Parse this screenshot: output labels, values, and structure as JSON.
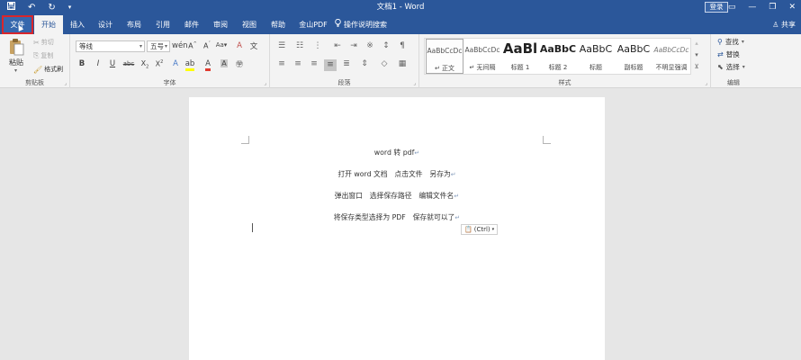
{
  "titlebar": {
    "title": "文档1 - Word",
    "login": "登录",
    "qat": {
      "save_icon": "save-icon",
      "undo_icon": "undo-icon",
      "redo_icon": "redo-icon",
      "customize_icon": "chevron-down-icon"
    },
    "window_buttons": [
      "▭",
      "—",
      "❐",
      "✕"
    ]
  },
  "tabs": [
    {
      "label": "文件"
    },
    {
      "label": "开始"
    },
    {
      "label": "插入"
    },
    {
      "label": "设计"
    },
    {
      "label": "布局"
    },
    {
      "label": "引用"
    },
    {
      "label": "邮件"
    },
    {
      "label": "审阅"
    },
    {
      "label": "视图"
    },
    {
      "label": "帮助"
    },
    {
      "label": "金山PDF"
    },
    {
      "label": "操作说明搜索"
    }
  ],
  "share": "共享",
  "clipboard": {
    "paste": "粘贴",
    "cut": "剪切",
    "copy": "复制",
    "format_painter": "格式刷",
    "group_label": "剪贴板"
  },
  "font": {
    "font_name": "等线",
    "font_size": "五号",
    "group_label": "字体"
  },
  "paragraph": {
    "group_label": "段落"
  },
  "styles": {
    "group_label": "样式",
    "items": [
      {
        "preview": "AaBbCcDc",
        "name": "↵ 正文"
      },
      {
        "preview": "AaBbCcDc",
        "name": "↵ 无间隔"
      },
      {
        "preview": "AaBl",
        "name": "标题 1"
      },
      {
        "preview": "AaBbC",
        "name": "标题 2"
      },
      {
        "preview": "AaBbC",
        "name": "标题"
      },
      {
        "preview": "AaBbC",
        "name": "副标题"
      },
      {
        "preview": "AaBbCcDc",
        "name": "不明显强调"
      }
    ]
  },
  "editing": {
    "find": "查找",
    "replace": "替换",
    "select": "选择",
    "group_label": "编辑"
  },
  "document": {
    "lines": [
      "word 转 pdf",
      "打开 word 文档　点击文件　另存为",
      "弹出窗口　选择保存路径　编辑文件名",
      "将保存类型选择为 PDF　保存就可以了"
    ],
    "paste_options": "(Ctrl)"
  }
}
